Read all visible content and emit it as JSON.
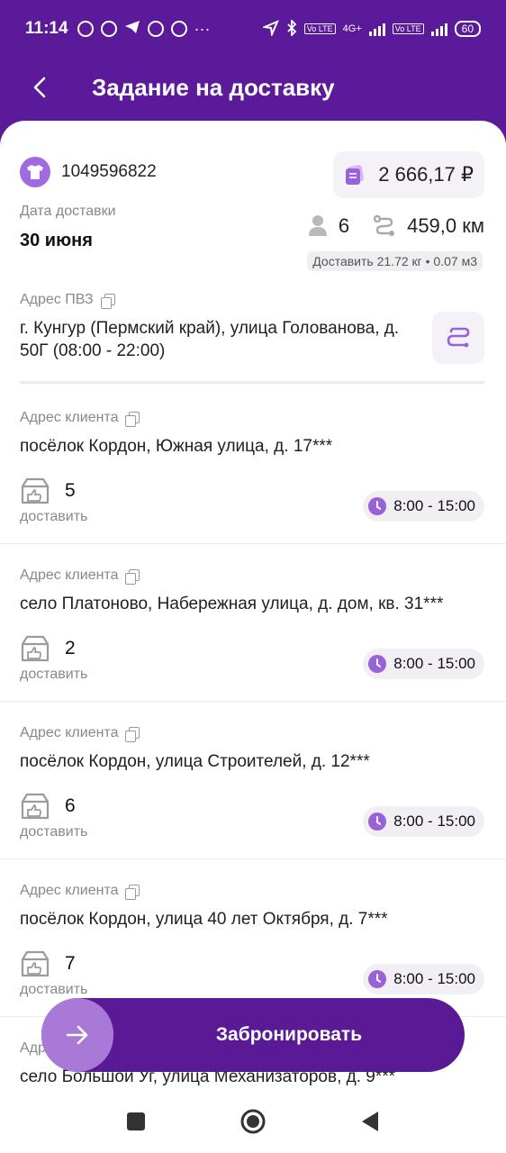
{
  "status_bar": {
    "time": "11:14",
    "dots": "···",
    "lte_label": "Vo LTE",
    "net_label": "4G+",
    "battery": "60"
  },
  "header": {
    "title": "Задание на доставку"
  },
  "order": {
    "id": "1049596822",
    "price": "2 666,17 ₽",
    "date_label": "Дата доставки",
    "date_value": "30 июня",
    "points_count": "6",
    "distance": "459,0 км",
    "weight_note": "Доставить 21.72 кг • 0.07 м3"
  },
  "pvz": {
    "label": "Адрес ПВЗ",
    "address": "г. Кунгур (Пермский край), улица Голованова, д. 50Г (08:00 - 22:00)"
  },
  "clients": [
    {
      "label": "Адрес клиента",
      "address": "посёлок Кордон, Южная улица, д. 17***",
      "count": "5",
      "action": "доставить",
      "time": "8:00 - 15:00"
    },
    {
      "label": "Адрес клиента",
      "address": "село Платоново, Набережная улица, д. дом, кв. 31***",
      "count": "2",
      "action": "доставить",
      "time": "8:00 - 15:00"
    },
    {
      "label": "Адрес клиента",
      "address": "посёлок Кордон, улица Строителей, д. 12***",
      "count": "6",
      "action": "доставить",
      "time": "8:00 - 15:00"
    },
    {
      "label": "Адрес клиента",
      "address": "посёлок Кордон, улица 40 лет Октября, д. 7***",
      "count": "7",
      "action": "доставить",
      "time": "8:00 - 15:00"
    },
    {
      "label": "Адрес клиента",
      "address": "село Большой Уг, улица Механизаторов, д. 9***"
    }
  ],
  "book_button": {
    "label": "Забронировать"
  },
  "colors": {
    "brand": "#5b1a9a",
    "accent": "#a879d6",
    "icon": "#9a62d8"
  }
}
